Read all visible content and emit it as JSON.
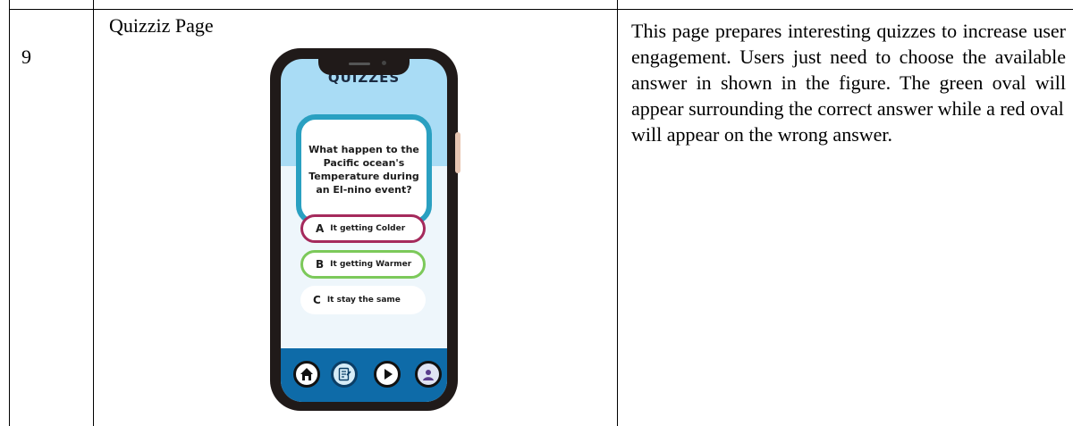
{
  "row": {
    "number": "9",
    "page_name": "Quizziz Page",
    "description": {
      "para1": "This page prepares interesting quizzes to increase user engagement. Users just need to choose the available answer in shown in the figure. The green oval will appear surrounding the correct answer while a red oval",
      "para2": "will appear on the wrong answer."
    }
  },
  "phone": {
    "title": "QUIZZES",
    "question": "What happen to the Pacific ocean's Temperature during an El-nino event?",
    "answers": [
      {
        "letter": "A",
        "label": "It getting Colder",
        "state": "wrong",
        "color": "#a52a5c"
      },
      {
        "letter": "B",
        "label": "It getting Warmer",
        "state": "correct",
        "color": "#7cc95a"
      },
      {
        "letter": "C",
        "label": "It stay the same",
        "state": "none"
      }
    ],
    "nav_icons": [
      "home-icon",
      "notes-icon",
      "play-icon",
      "profile-icon"
    ],
    "colors": {
      "header": "#a9dcf5",
      "card_border": "#2aa0c1",
      "navbar": "#0e6ba8"
    }
  }
}
